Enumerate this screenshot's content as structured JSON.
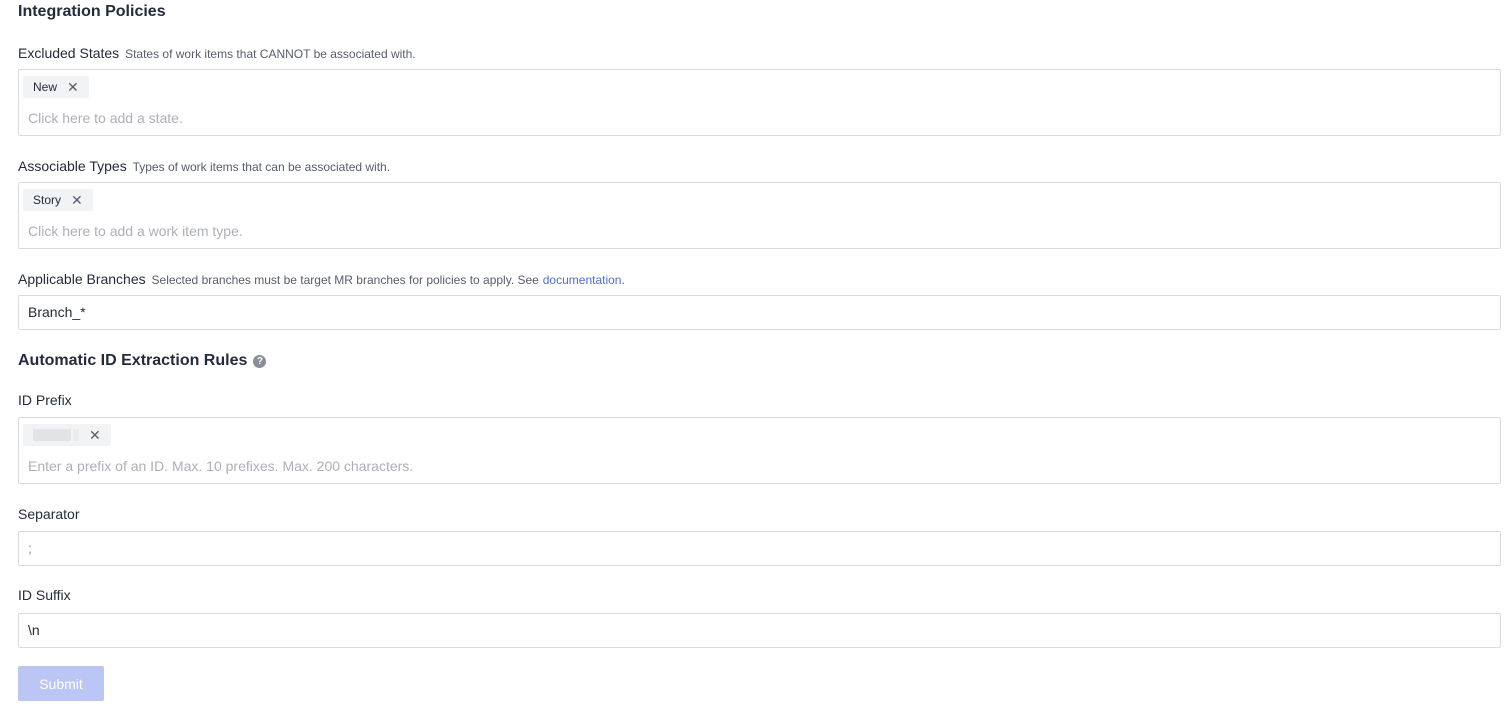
{
  "page_title": "Integration Policies",
  "excluded_states": {
    "label": "Excluded States",
    "hint": "States of work items that CANNOT be associated with.",
    "tags": [
      "New"
    ],
    "placeholder": "Click here to add a state."
  },
  "associable_types": {
    "label": "Associable Types",
    "hint": "Types of work items that can be associated with.",
    "tags": [
      "Story"
    ],
    "placeholder": "Click here to add a work item type."
  },
  "applicable_branches": {
    "label": "Applicable Branches",
    "hint": "Selected branches must be target MR branches for policies to apply. See",
    "link": "documentation",
    "hint_end": ".",
    "value": "Branch_*"
  },
  "extraction_rules": {
    "title": "Automatic ID Extraction Rules",
    "help_icon": "question-circle-icon"
  },
  "id_prefix": {
    "label": "ID Prefix",
    "placeholder": "Enter a prefix of an ID. Max. 10 prefixes. Max. 200 characters."
  },
  "separator": {
    "label": "Separator",
    "value": ";"
  },
  "id_suffix": {
    "label": "ID Suffix",
    "value": "\\n"
  },
  "submit_label": "Submit",
  "colors": {
    "accent": "#526ecc",
    "submit_disabled": "#bcc6f5",
    "border": "#d9dbe0"
  }
}
